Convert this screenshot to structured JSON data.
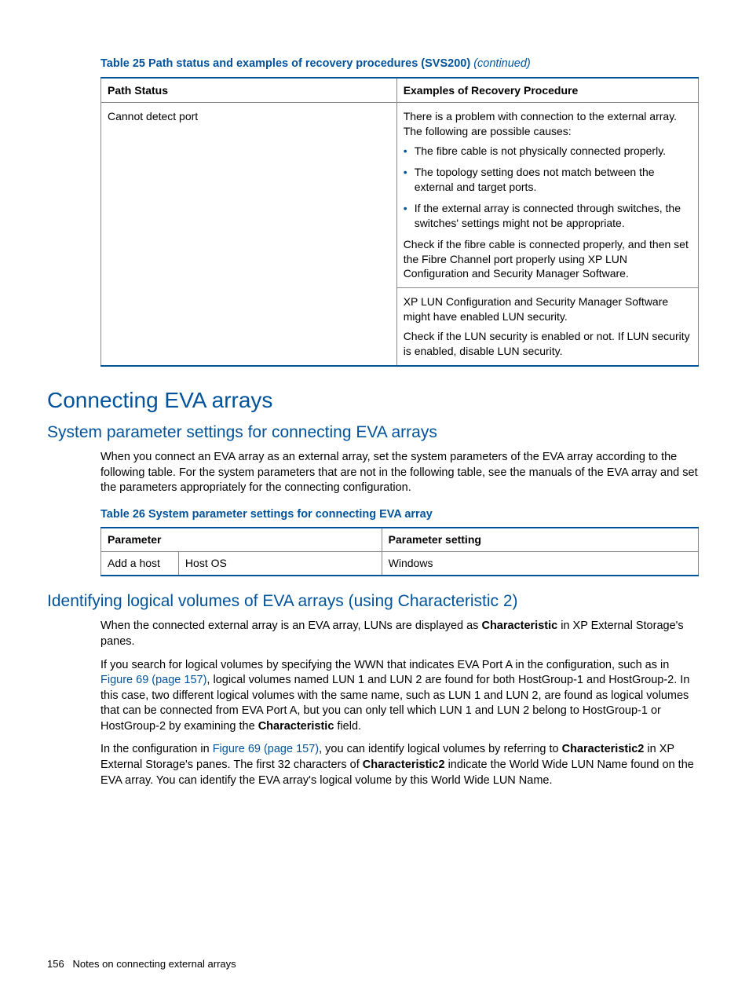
{
  "table25": {
    "caption_bold": "Table 25 Path status and examples of recovery procedures (SVS200)",
    "caption_italic": " (continued)",
    "header": {
      "col1": "Path Status",
      "col2": "Examples of Recovery Procedure"
    },
    "row1": {
      "col1": "Cannot detect port",
      "cell1_para1": "There is a problem with connection to the external array. The following are possible causes:",
      "bullets": [
        "The fibre cable is not physically connected properly.",
        "The topology setting does not match between the external and target ports.",
        "If the external array is connected through switches, the switches' settings might not be appropriate."
      ],
      "cell1_para2": "Check if the fibre cable is connected properly, and then set the Fibre Channel port properly using XP LUN Configuration and Security Manager Software.",
      "cell2_para1": "XP LUN Configuration and Security Manager Software might have enabled LUN security.",
      "cell2_para2": "Check if the LUN security is enabled or not. If LUN security is enabled, disable LUN security."
    }
  },
  "headings": {
    "h1": "Connecting EVA arrays",
    "h2a": "System parameter settings for connecting EVA arrays",
    "h2b": "Identifying logical volumes of EVA arrays (using Characteristic 2)"
  },
  "para1": "When you connect an EVA array as an external array, set the system parameters of the EVA array according to the following table. For the system parameters that are not in the following table, see the manuals of the EVA array and set the parameters appropriately for the connecting configuration.",
  "table26": {
    "caption": "Table 26 System parameter settings for connecting EVA array",
    "header": {
      "col1": "Parameter",
      "col2": "Parameter setting"
    },
    "row": {
      "c1": "Add a host",
      "c2": "Host OS",
      "c3": "Windows"
    }
  },
  "para2": {
    "pre": "When the connected external array is an EVA array, LUNs are displayed as ",
    "bold": "Characteristic",
    "post": " in XP External Storage's panes."
  },
  "para3": {
    "pre": "If you search for logical volumes by specifying the WWN that indicates EVA Port A in the configuration, such as in ",
    "link": "Figure 69 (page 157)",
    "post": ", logical volumes named LUN 1 and LUN 2 are found for both HostGroup-1 and HostGroup-2. In this case, two different logical volumes with the same name, such as LUN 1 and LUN 2, are found as logical volumes that can be connected from EVA Port A, but you can only tell which LUN 1 and LUN 2 belong to HostGroup-1 or HostGroup-2 by examining the ",
    "bold": "Characteristic",
    "post2": " field."
  },
  "para4": {
    "pre": "In the configuration in ",
    "link": "Figure 69 (page 157)",
    "mid1": ", you can identify logical volumes by referring to ",
    "bold1": "Characteristic2",
    "mid2": " in XP External Storage's panes. The first 32 characters of ",
    "bold2": "Characteristic2",
    "post": " indicate the World Wide LUN Name found on the EVA array. You can identify the EVA array's logical volume by this World Wide LUN Name."
  },
  "footer": {
    "page": "156",
    "text": "Notes on connecting external arrays"
  }
}
